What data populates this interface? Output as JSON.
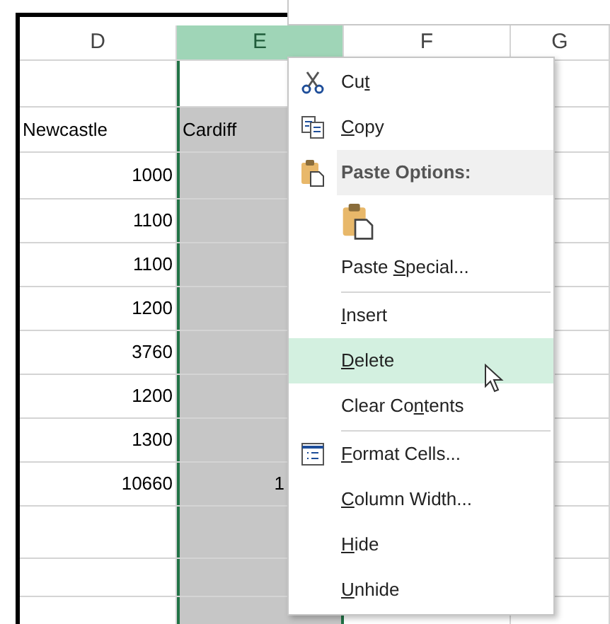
{
  "sheet": {
    "columns": [
      {
        "label": "D",
        "selected": false
      },
      {
        "label": "E",
        "selected": true
      },
      {
        "label": "F",
        "selected": false
      },
      {
        "label": "G",
        "selected": false
      }
    ],
    "rows": [
      {
        "kind": "blank",
        "cells": [
          null,
          null
        ]
      },
      {
        "kind": "label",
        "cells": [
          "Newcastle",
          "Cardiff"
        ]
      },
      {
        "kind": "value",
        "cells": [
          "1000",
          null
        ]
      },
      {
        "kind": "value",
        "cells": [
          "1100",
          null
        ]
      },
      {
        "kind": "value",
        "cells": [
          "1100",
          null
        ]
      },
      {
        "kind": "value",
        "cells": [
          "1200",
          null
        ]
      },
      {
        "kind": "value",
        "cells": [
          "3760",
          null
        ]
      },
      {
        "kind": "value",
        "cells": [
          "1200",
          null
        ]
      },
      {
        "kind": "value",
        "cells": [
          "1300",
          null
        ]
      },
      {
        "kind": "value",
        "cells": [
          "10660",
          "1"
        ]
      },
      {
        "kind": "blank",
        "cells": [
          null,
          null
        ]
      },
      {
        "kind": "blank",
        "cells": [
          null,
          null
        ]
      },
      {
        "kind": "blank",
        "cells": [
          null,
          null
        ]
      }
    ]
  },
  "context_menu": {
    "items": [
      {
        "kind": "item",
        "before": "Cu",
        "key": "t",
        "highlighted": false
      },
      {
        "kind": "item",
        "key": "C",
        "after": "opy",
        "highlighted": false
      },
      {
        "kind": "header",
        "text": "Paste Options:"
      },
      {
        "kind": "paste-option"
      },
      {
        "kind": "item",
        "before": "Paste ",
        "key": "S",
        "after": "pecial...",
        "highlighted": false
      },
      {
        "kind": "separator"
      },
      {
        "kind": "item",
        "key": "I",
        "after": "nsert",
        "highlighted": false
      },
      {
        "kind": "item",
        "key": "D",
        "after": "elete",
        "highlighted": true
      },
      {
        "kind": "item",
        "before": "Clear Co",
        "key": "n",
        "after": "tents",
        "highlighted": false
      },
      {
        "kind": "separator"
      },
      {
        "kind": "item",
        "key": "F",
        "after": "ormat Cells...",
        "highlighted": false
      },
      {
        "kind": "item",
        "key": "C",
        "after": "olumn Width...",
        "highlighted": false
      },
      {
        "kind": "item",
        "key": "H",
        "after": "ide",
        "highlighted": false
      },
      {
        "kind": "item",
        "key": "U",
        "after": "nhide",
        "highlighted": false
      }
    ]
  }
}
